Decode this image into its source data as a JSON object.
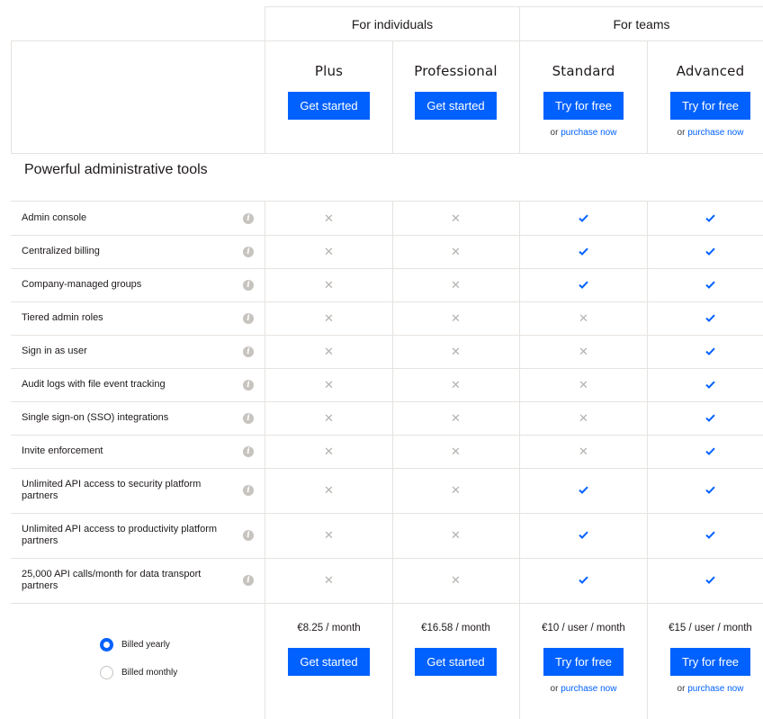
{
  "groups": {
    "individuals": "For individuals",
    "teams": "For teams"
  },
  "plans": [
    {
      "name": "Plus",
      "cta": "Get started",
      "purchase_or": "",
      "purchase_link": "",
      "price": "€8.25 / month"
    },
    {
      "name": "Professional",
      "cta": "Get started",
      "purchase_or": "",
      "purchase_link": "",
      "price": "€16.58 / month"
    },
    {
      "name": "Standard",
      "cta": "Try for free",
      "purchase_or": "or",
      "purchase_link": "purchase now",
      "price": "€10 / user / month"
    },
    {
      "name": "Advanced",
      "cta": "Try for free",
      "purchase_or": "or",
      "purchase_link": "purchase now",
      "price": "€15 / user / month"
    }
  ],
  "section_title": "Powerful administrative tools",
  "features": [
    {
      "label": "Admin console",
      "availability": [
        false,
        false,
        true,
        true
      ]
    },
    {
      "label": "Centralized billing",
      "availability": [
        false,
        false,
        true,
        true
      ]
    },
    {
      "label": "Company-managed groups",
      "availability": [
        false,
        false,
        true,
        true
      ]
    },
    {
      "label": "Tiered admin roles",
      "availability": [
        false,
        false,
        false,
        true
      ]
    },
    {
      "label": "Sign in as user",
      "availability": [
        false,
        false,
        false,
        true
      ]
    },
    {
      "label": "Audit logs with file event tracking",
      "availability": [
        false,
        false,
        false,
        true
      ]
    },
    {
      "label": "Single sign-on (SSO) integrations",
      "availability": [
        false,
        false,
        false,
        true
      ]
    },
    {
      "label": "Invite enforcement",
      "availability": [
        false,
        false,
        false,
        true
      ]
    },
    {
      "label": "Unlimited API access to security platform partners",
      "availability": [
        false,
        false,
        true,
        true
      ]
    },
    {
      "label": "Unlimited API access to productivity platform partners",
      "availability": [
        false,
        false,
        true,
        true
      ]
    },
    {
      "label": "25,000 API calls/month for data transport partners",
      "availability": [
        false,
        false,
        true,
        true
      ]
    }
  ],
  "billing": {
    "yearly": "Billed yearly",
    "monthly": "Billed monthly",
    "selected": "yearly"
  },
  "icons": {
    "unavailable": "close-icon",
    "available": "check-icon",
    "info": "info-icon"
  },
  "colors": {
    "accent": "#0061fe",
    "border": "#e6e3df",
    "muted": "#b5b1ad"
  }
}
